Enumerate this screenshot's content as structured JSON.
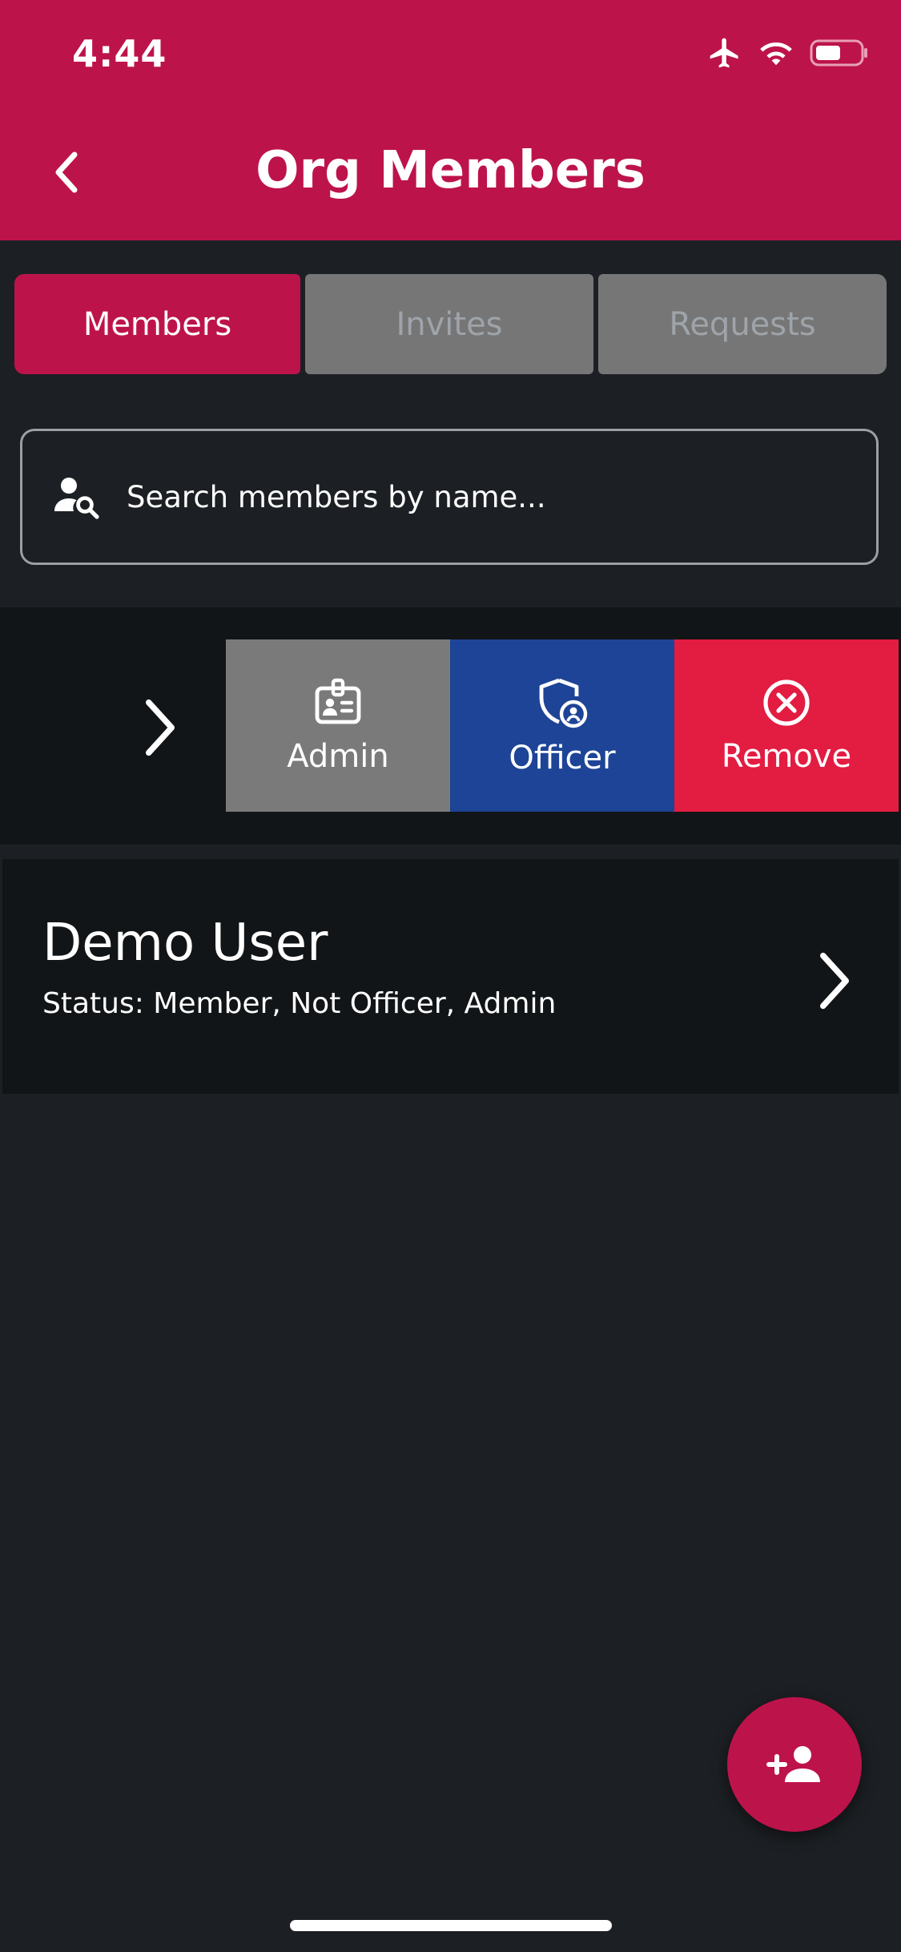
{
  "status_bar": {
    "time": "4:44",
    "icons": [
      "airplane-icon",
      "wifi-icon",
      "battery-icon"
    ]
  },
  "header": {
    "title": "Org Members",
    "back_icon": "chevron-left-icon"
  },
  "tabs": [
    {
      "label": "Members",
      "active": true
    },
    {
      "label": "Invites",
      "active": false
    },
    {
      "label": "Requests",
      "active": false
    }
  ],
  "search": {
    "placeholder": "Search members by name...",
    "icon": "person-search-icon"
  },
  "swipe_actions": [
    {
      "label": "Admin",
      "icon": "badge-icon",
      "color": "#7a7a7a"
    },
    {
      "label": "Officer",
      "icon": "shield-user-icon",
      "color": "#1d4496"
    },
    {
      "label": "Remove",
      "icon": "circle-x-icon",
      "color": "#e31c42"
    }
  ],
  "members": [
    {
      "name": "Demo User",
      "status": "Status: Member, Not Officer, Admin"
    }
  ],
  "fab": {
    "icon": "add-person-icon"
  },
  "colors": {
    "brand": "#bd134b",
    "background": "#1c1f23",
    "row": "#121517",
    "tab_inactive": "#767676"
  }
}
